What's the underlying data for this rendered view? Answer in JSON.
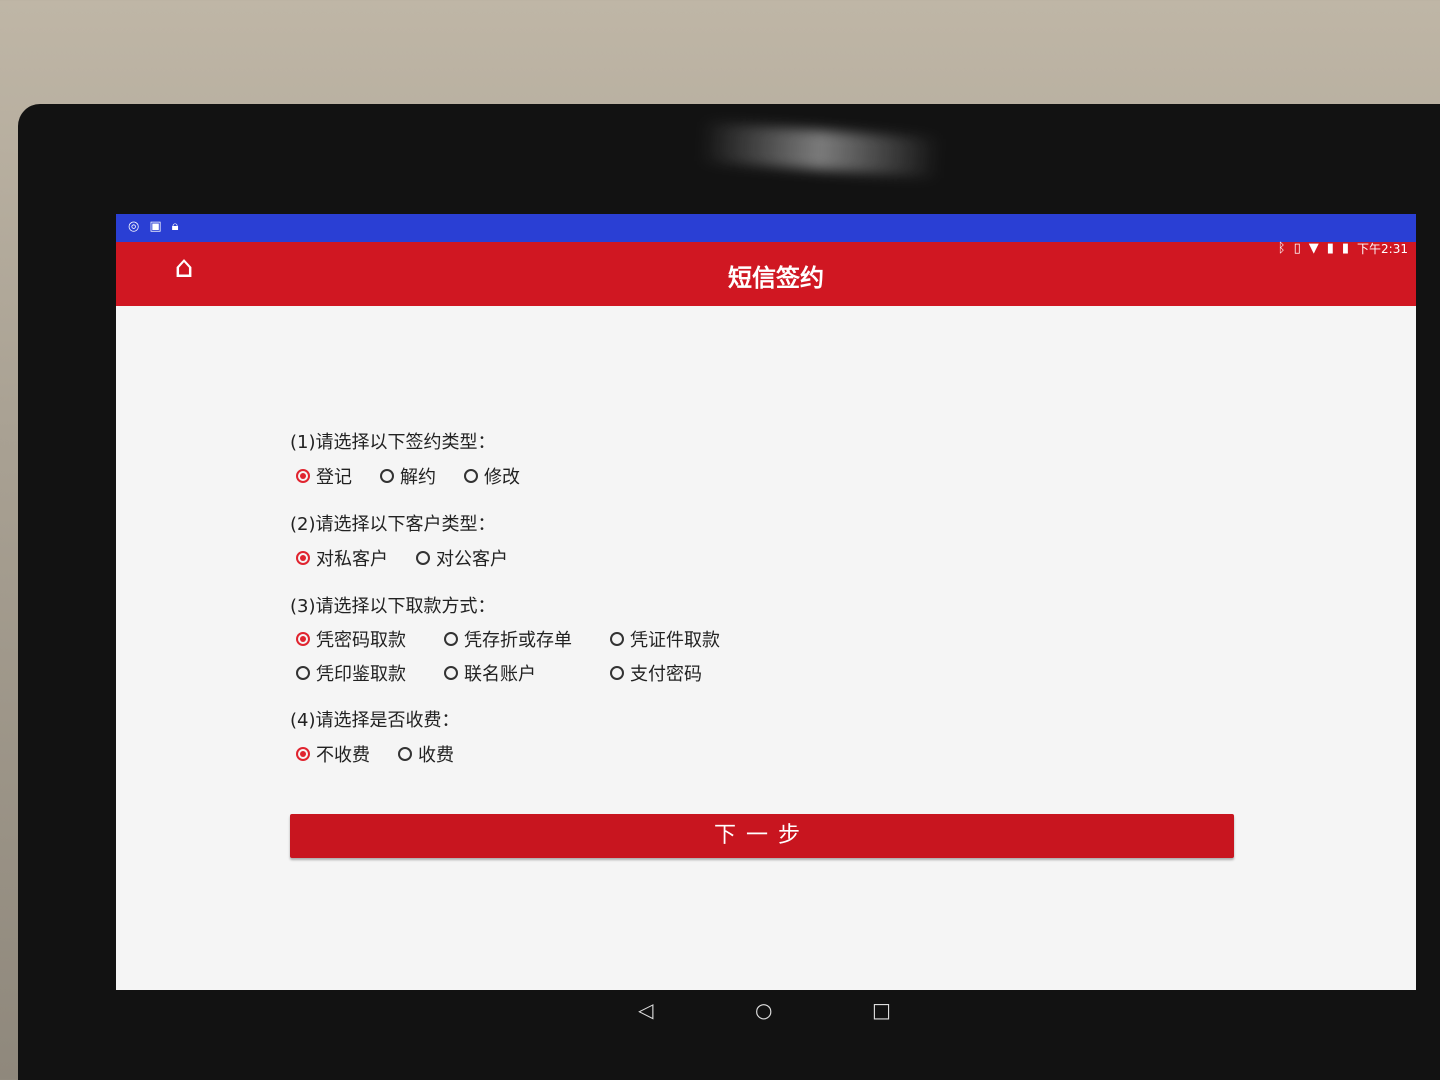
{
  "status_bar": {
    "left_icons": [
      "status-circle-icon",
      "gallery-app-icon",
      "lock-icon"
    ],
    "right_icons": [
      "bluetooth-icon",
      "vibrate-icon",
      "wifi-icon",
      "signal-icon",
      "battery-icon"
    ],
    "time": "下午2:31"
  },
  "app_bar": {
    "title": "短信签约",
    "home_icon": "home-icon"
  },
  "form": {
    "q1": {
      "label": "(1)请选择以下签约类型：",
      "options": [
        "登记",
        "解约",
        "修改"
      ],
      "selected": 0
    },
    "q2": {
      "label": "(2)请选择以下客户类型：",
      "options": [
        "对私客户",
        "对公客户"
      ],
      "selected": 0
    },
    "q3": {
      "label": "(3)请选择以下取款方式：",
      "options": [
        "凭密码取款",
        "凭存折或存单",
        "凭证件取款",
        "凭印鉴取款",
        "联名账户",
        "支付密码"
      ],
      "selected": 0
    },
    "q4": {
      "label": "(4)请选择是否收费：",
      "options": [
        "不收费",
        "收费"
      ],
      "selected": 0
    },
    "next_label": "下一步"
  },
  "nav_bar": {
    "back": "◁",
    "home": "○",
    "recents": "□"
  },
  "colors": {
    "status_bar": "#2a3fd4",
    "app_bar": "#d01722",
    "button": "#c8151f",
    "radio_selected": "#e0242f"
  }
}
